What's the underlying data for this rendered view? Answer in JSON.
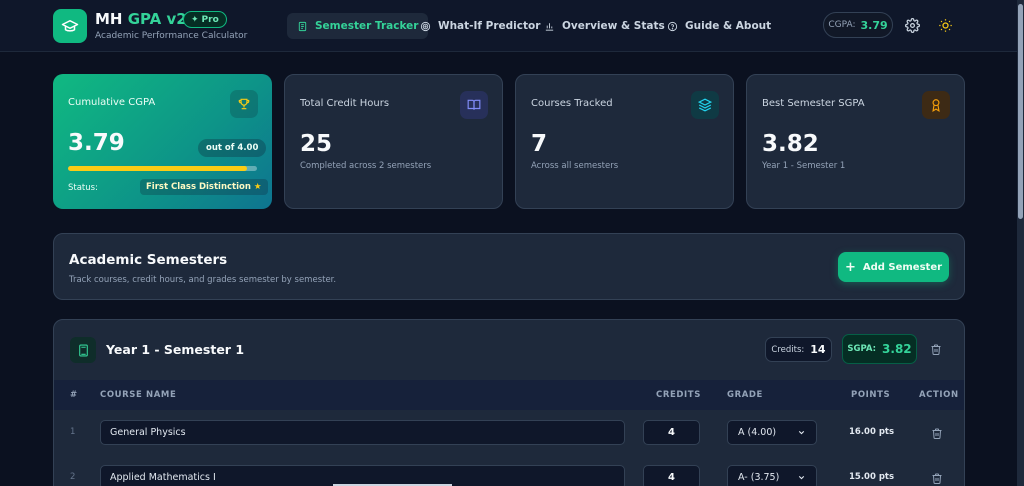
{
  "brand": {
    "title_prefix": "MH",
    "title_accent": "GPA v2",
    "badge": "Pro",
    "subtitle": "Academic Performance Calculator"
  },
  "nav": [
    {
      "label": "Semester Tracker",
      "icon": "clipboard-icon",
      "active": true
    },
    {
      "label": "What-If Predictor",
      "icon": "target-icon",
      "active": false
    },
    {
      "label": "Overview & Stats",
      "icon": "bar-chart-icon",
      "active": false
    },
    {
      "label": "Guide & About",
      "icon": "help-circle-icon",
      "active": false
    }
  ],
  "header": {
    "cgpa_label": "CGPA:",
    "cgpa_value": "3.79"
  },
  "colors": {
    "accent": "#10b981",
    "background": "#0b1120",
    "card": "#1e293b",
    "progress": "#facc15"
  },
  "stats": {
    "cgpa": {
      "label": "Cumulative CGPA",
      "value": "3.79",
      "out_of": "out of 4.00",
      "progress_fraction": 0.9475,
      "status_label": "Status:",
      "status_value": "First Class Distinction",
      "icon": "trophy-icon"
    },
    "credits": {
      "label": "Total Credit Hours",
      "value": "25",
      "sub": "Completed across 2 semesters",
      "icon": "book-icon"
    },
    "courses": {
      "label": "Courses Tracked",
      "value": "7",
      "sub": "Across all semesters",
      "icon": "layers-icon"
    },
    "best": {
      "label": "Best Semester SGPA",
      "value": "3.82",
      "sub": "Year 1 - Semester 1",
      "icon": "award-icon"
    }
  },
  "semesters_section": {
    "title": "Academic Semesters",
    "subtitle": "Track courses, credit hours, and grades semester by semester.",
    "add_label": "Add Semester"
  },
  "semester": {
    "name": "Year 1 - Semester 1",
    "credits_label": "Credits:",
    "credits_value": "14",
    "sgpa_label": "SGPA:",
    "sgpa_value": "3.82",
    "columns": [
      "#",
      "COURSE NAME",
      "CREDITS",
      "GRADE",
      "POINTS",
      "ACTION"
    ],
    "courses": [
      {
        "num": "1",
        "name": "General Physics",
        "credits": "4",
        "grade": "A (4.00)",
        "points": "16.00 pts"
      },
      {
        "num": "2",
        "name": "Applied Mathematics I",
        "credits": "4",
        "grade": "A- (3.75)",
        "points": "15.00 pts"
      }
    ]
  }
}
